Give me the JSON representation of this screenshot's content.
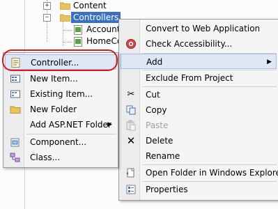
{
  "tree": {
    "content_label": "Content",
    "controllers_label": "Controllers",
    "account_label": "Account",
    "homec_label": "HomeCo"
  },
  "main_menu": {
    "items": [
      {
        "label": "Convert to Web Application",
        "icon": "none"
      },
      {
        "label": "Check Accessibility...",
        "icon": "accessibility-icon"
      },
      {
        "label": "Add",
        "icon": "none",
        "submenu": true
      },
      {
        "label": "Exclude From Project",
        "icon": "none"
      },
      {
        "label": "Cut",
        "icon": "scissors-icon"
      },
      {
        "label": "Copy",
        "icon": "copy-icon"
      },
      {
        "label": "Paste",
        "icon": "paste-icon",
        "disabled": true
      },
      {
        "label": "Delete",
        "icon": "delete-x-icon"
      },
      {
        "label": "Rename",
        "icon": "none"
      },
      {
        "label": "Open Folder in Windows Explorer",
        "icon": "open-folder-icon"
      },
      {
        "label": "Properties",
        "icon": "properties-icon"
      }
    ]
  },
  "add_menu": {
    "items": [
      {
        "label": "Controller...",
        "icon": "controller-icon"
      },
      {
        "label": "New Item...",
        "icon": "new-item-icon"
      },
      {
        "label": "Existing Item...",
        "icon": "existing-item-icon"
      },
      {
        "label": "New Folder",
        "icon": "folder-icon"
      },
      {
        "label": "Add ASP.NET Folder",
        "icon": "none",
        "submenu": true
      },
      {
        "label": "Component...",
        "icon": "component-icon"
      },
      {
        "label": "Class...",
        "icon": "class-icon"
      }
    ]
  },
  "colors": {
    "selection": "#3a6fc4",
    "highlight_circle": "#d6191c",
    "menu_background": "#f5f5f5"
  }
}
